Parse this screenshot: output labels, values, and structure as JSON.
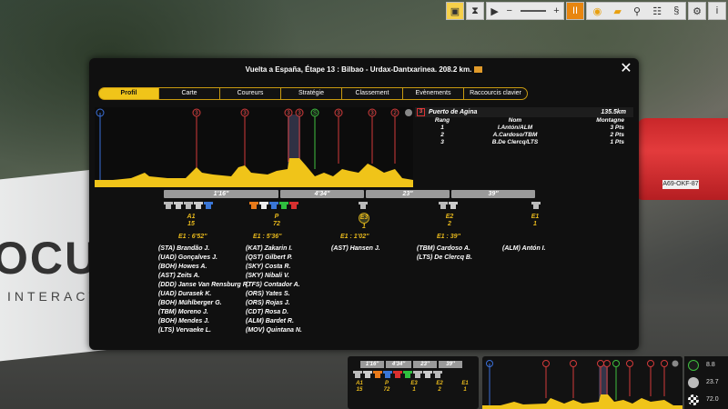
{
  "toolbar": {
    "buttons": [
      "save-icon",
      "hourglass-icon",
      "play-speed-icon",
      "pause-icon",
      "view-icon",
      "camera-icon",
      "settings-icon",
      "info-icon"
    ],
    "speed_minus": "−",
    "speed_plus": "+",
    "pause": "II"
  },
  "panel": {
    "title": "Vuelta a España, Étape 13 : Bilbao - Urdax-Dantxarinea. 208.2 km.",
    "close": "✕"
  },
  "tabs": [
    "Profil",
    "Carte",
    "Coureurs",
    "Stratégie",
    "Classement",
    "Evènements",
    "Raccourcis clavier"
  ],
  "active_tab": "Profil",
  "climb": {
    "number": "3",
    "name": "Puerto de Agina",
    "km": "135.5km",
    "headers": [
      "Rang",
      "Nom",
      "Montagne"
    ],
    "rows": [
      [
        "1",
        "I.Antón/ALM",
        "3 Pts"
      ],
      [
        "2",
        "A.Cardoso/TBM",
        "2 Pts"
      ],
      [
        "3",
        "B.De Clercq/LTS",
        "1 Pts"
      ]
    ]
  },
  "profile_markers": [
    "3",
    "3",
    "3",
    "3",
    "S",
    "3",
    "3",
    "2"
  ],
  "gap_bars": [
    "1'16''",
    "4'34''",
    "23''",
    "39''"
  ],
  "groups": [
    {
      "code": "A1",
      "count": "15",
      "time": "E1 : 6'52''",
      "riders": [
        "(STA) Brandão J.",
        "(UAD) Gonçalves J.",
        "(BOH) Howes A.",
        "(AST) Zeits A.",
        "(DDD) Janse Van Rensburg R.",
        "(UAD) Durasek K.",
        "(BOH) Mühlberger G.",
        "(TBM) Moreno J.",
        "(BOH) Mendes J.",
        "(LTS) Vervaeke L."
      ]
    },
    {
      "code": "P",
      "count": "72",
      "time": "E1 : 5'36''",
      "riders": [
        "(KAT) Zakarin I.",
        "(QST) Gilbert P.",
        "(SKY) Costa R.",
        "(SKY) Nibali V.",
        "(TFS) Contador A.",
        "(ORS) Yates S.",
        "(ORS) Rojas J.",
        "(CDT) Rosa D.",
        "(ALM) Bardet R.",
        "(MOV) Quintana N."
      ]
    },
    {
      "code": "E3",
      "count": "1",
      "time": "E1 : 1'02''",
      "riders": [
        "(AST) Hansen J."
      ]
    },
    {
      "code": "E2",
      "count": "2",
      "time": "E1 : 39''",
      "riders": [
        "(TBM) Cardoso A.",
        "(LTS) De Clercq B."
      ]
    },
    {
      "code": "E1",
      "count": "1",
      "time": "",
      "riders": [
        "(ALM) Antón I."
      ]
    }
  ],
  "mini": {
    "gaps": [
      "1'16''",
      "4'34''",
      "23''",
      "39''"
    ],
    "codes": [
      "A1",
      "P",
      "E3",
      "E2",
      "E1"
    ],
    "counts": [
      "15",
      "72",
      "1",
      "2",
      "1"
    ]
  },
  "stats": [
    {
      "icon": "speed-icon",
      "value": "8.8"
    },
    {
      "icon": "temperature-icon",
      "value": "23.7"
    },
    {
      "icon": "finish-flag-icon",
      "value": "72.0"
    }
  ],
  "banner": {
    "logo": "OCUS",
    "sub": "INTERACT"
  },
  "car_plate": "A69-OKF-87",
  "colors": {
    "accent": "#f0c419",
    "panel": "#101010",
    "climb": "#e23b3b",
    "sprint": "#3fbf3f"
  }
}
